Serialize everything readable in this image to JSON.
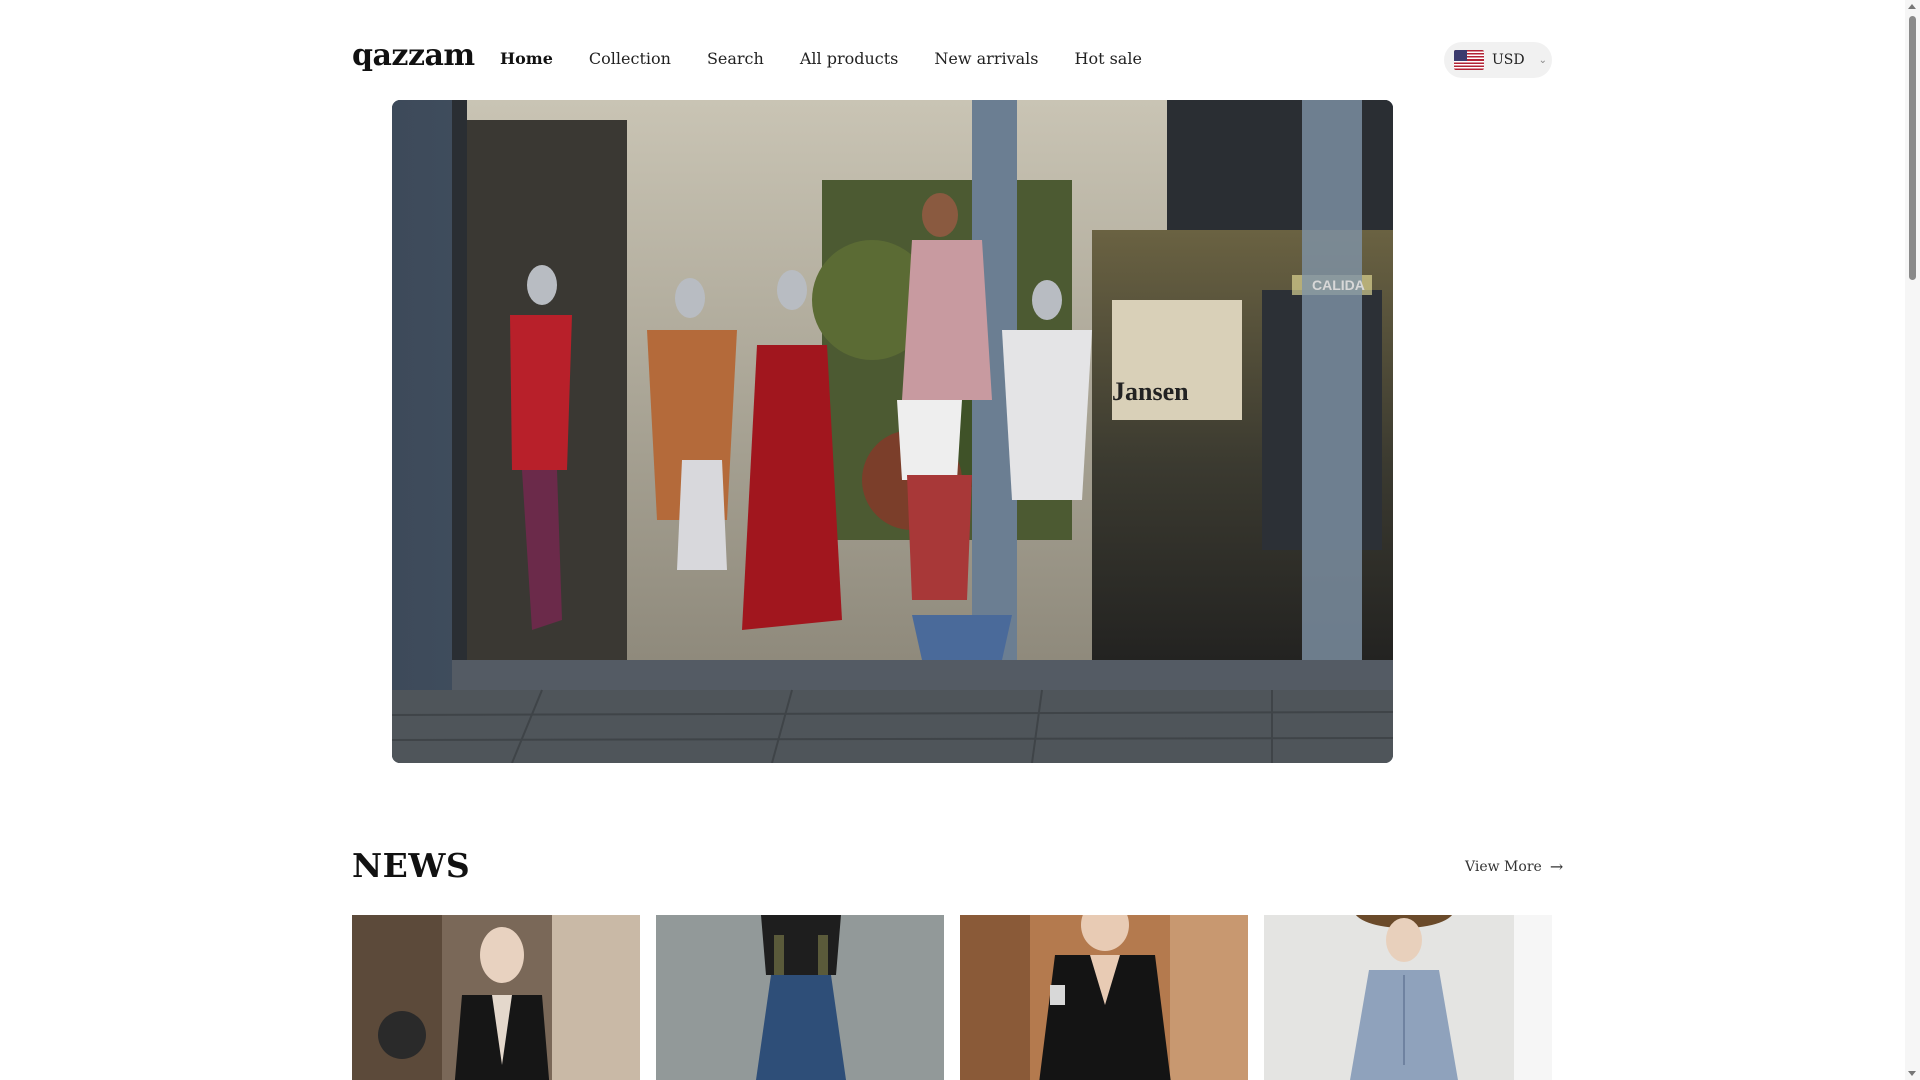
{
  "header": {
    "logo": "qazzam",
    "nav": [
      {
        "label": "Home",
        "active": true
      },
      {
        "label": "Collection",
        "active": false
      },
      {
        "label": "Search",
        "active": false
      },
      {
        "label": "All products",
        "active": false
      },
      {
        "label": "New arrivals",
        "active": false
      },
      {
        "label": "Hot sale",
        "active": false
      }
    ],
    "currency": {
      "code": "USD",
      "flag_icon": "us-flag-icon"
    }
  },
  "hero": {
    "image": "storefront-window-mannequins",
    "store_signs": [
      "CALIDA",
      "Jansen"
    ]
  },
  "news": {
    "title": "NEWS",
    "view_more": "View More",
    "products": [
      {
        "image": "black-velvet-halter-dress"
      },
      {
        "image": "denim-overall-dress"
      },
      {
        "image": "black-lace-v-neck-dress"
      },
      {
        "image": "light-blue-linen-dress"
      }
    ]
  },
  "colors": {
    "accent": "#111111",
    "pill_bg": "#f1f1f1"
  }
}
